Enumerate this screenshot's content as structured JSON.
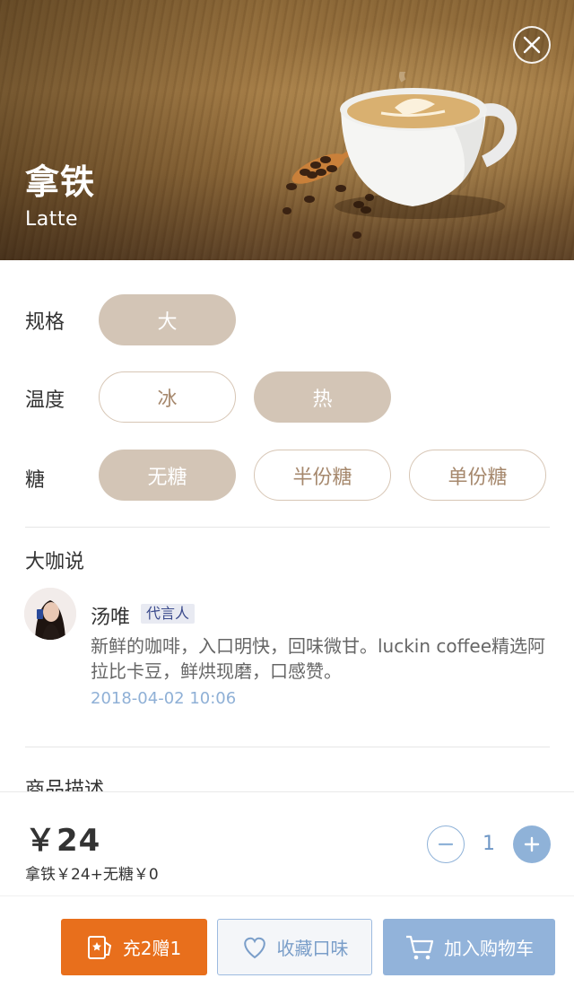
{
  "product": {
    "name_cn": "拿铁",
    "name_en": "Latte"
  },
  "options": {
    "size": {
      "label": "规格",
      "choices": [
        {
          "text": "大",
          "selected": true
        }
      ]
    },
    "temperature": {
      "label": "温度",
      "choices": [
        {
          "text": "冰",
          "selected": false
        },
        {
          "text": "热",
          "selected": true
        }
      ]
    },
    "sugar": {
      "label": "糖",
      "choices": [
        {
          "text": "无糖",
          "selected": true
        },
        {
          "text": "半份糖",
          "selected": false
        },
        {
          "text": "单份糖",
          "selected": false
        }
      ]
    }
  },
  "review_section": {
    "title": "大咖说",
    "author": "汤唯",
    "badge": "代言人",
    "quote": "新鲜的咖啡，入口明快，回味微甘。luckin coffee精选阿拉比卡豆，鲜烘现磨，口感赞。",
    "date": "2018-04-02 10:06"
  },
  "description_section": {
    "title": "商品描述"
  },
  "price_bar": {
    "price": "￥24",
    "detail": "拿铁￥24+无糖￥0",
    "quantity": "1"
  },
  "actions": {
    "recharge": "充2赠1",
    "favorite": "收藏口味",
    "cart": "加入购物车"
  },
  "icons": {
    "close": "close-icon",
    "minus": "minus-icon",
    "plus": "plus-icon",
    "recharge": "recharge-card-icon",
    "favorite": "heart-icon",
    "cart": "cart-icon"
  },
  "colors": {
    "selected_pill": "#d3c5b6",
    "unselected_text": "#a6886d",
    "accent_blue": "#8fb2d8",
    "recharge_orange": "#e86f1c",
    "date_blue": "#8fb0d6"
  }
}
